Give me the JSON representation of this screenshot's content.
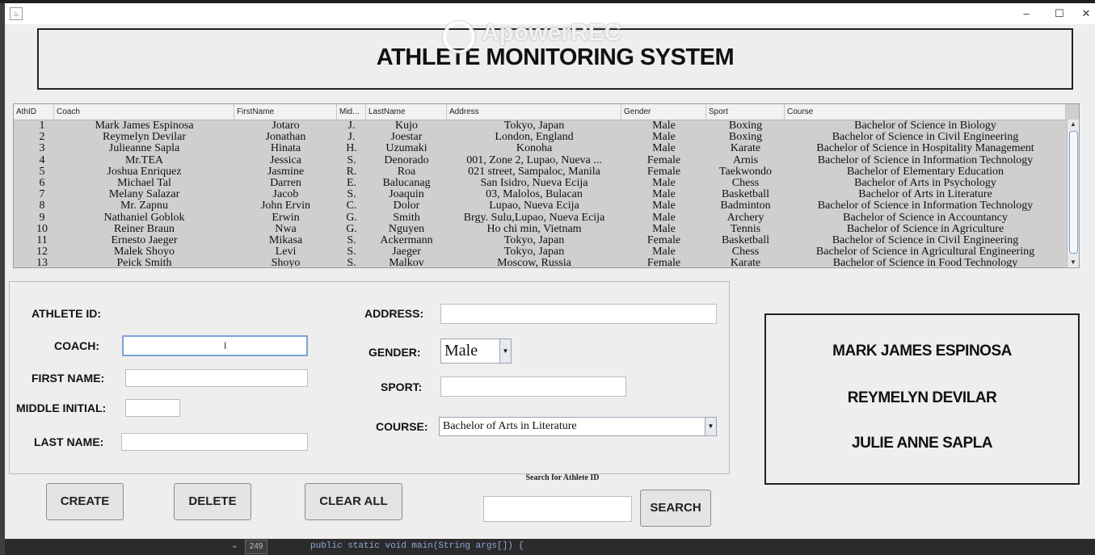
{
  "window": {
    "icon_glyph": "♨",
    "minimize": "–",
    "maximize": "☐",
    "close": "✕"
  },
  "header": {
    "title": "ATHLETE MONITORING SYSTEM",
    "watermark": "ApowerREC"
  },
  "table": {
    "columns": [
      "AthID",
      "Coach",
      "FirstName",
      "Mid...",
      "LastName",
      "Address",
      "Gender",
      "Sport",
      "Course"
    ],
    "rows": [
      [
        "1",
        "Mark James Espinosa",
        "Jotaro",
        "J.",
        "Kujo",
        "Tokyo, Japan",
        "Male",
        "Boxing",
        "Bachelor of Science in Biology"
      ],
      [
        "2",
        "Reymelyn Devilar",
        "Jonathan",
        "J.",
        "Joestar",
        "London, England",
        "Male",
        "Boxing",
        "Bachelor of Science in Civil Engineering"
      ],
      [
        "3",
        "Julieanne Sapla",
        "Hinata",
        "H.",
        "Uzumaki",
        "Konoha",
        "Male",
        "Karate",
        "Bachelor of Science in Hospitality Management"
      ],
      [
        "4",
        "Mr.TEA",
        "Jessica",
        "S.",
        "Denorado",
        "001, Zone 2, Lupao, Nueva ...",
        "Female",
        "Arnis",
        "Bachelor of Science in Information Technology"
      ],
      [
        "5",
        "Joshua Enriquez",
        "Jasmine",
        "R.",
        "Roa",
        "021 street, Sampaloc, Manila",
        "Female",
        "Taekwondo",
        "Bachelor of Elementary Education"
      ],
      [
        "6",
        "Michael Tal",
        "Darren",
        "E.",
        "Balucanag",
        "San Isidro, Nueva Ecija",
        "Male",
        "Chess",
        "Bachelor of Arts in Psychology"
      ],
      [
        "7",
        "Melany Salazar",
        "Jacob",
        "S.",
        "Joaquin",
        "03, Malolos, Bulacan",
        "Male",
        "Basketball",
        "Bachelor of Arts in Literature"
      ],
      [
        "8",
        "Mr. Zapnu",
        "John Ervin",
        "C.",
        "Dolor",
        "Lupao, Nueva Ecija",
        "Male",
        "Badminton",
        "Bachelor of Science in Information Technology"
      ],
      [
        "9",
        "Nathaniel Goblok",
        "Erwin",
        "G.",
        "Smith",
        "Brgy. Sulu,Lupao, Nueva Ecija",
        "Male",
        "Archery",
        "Bachelor of Science in Accountancy"
      ],
      [
        "10",
        "Reiner Braun",
        "Nwa",
        "G.",
        "Nguyen",
        "Ho chi min, Vietnam",
        "Male",
        "Tennis",
        "Bachelor of Science in Agriculture"
      ],
      [
        "11",
        "Ernesto Jaeger",
        "Mikasa",
        "S.",
        "Ackermann",
        "Tokyo, Japan",
        "Female",
        "Basketball",
        "Bachelor of Science in Civil Engineering"
      ],
      [
        "12",
        "Malek Shoyo",
        "Levi",
        "S.",
        "Jaeger",
        "Tokyo, Japan",
        "Male",
        "Chess",
        "Bachelor of Science in Agricultural Engineering"
      ],
      [
        "13",
        "Peick Smith",
        "Shoyo",
        "S.",
        "Malkov",
        "Moscow, Russia",
        "Female",
        "Karate",
        "Bachelor of Science in Food Technology"
      ]
    ],
    "scroll_up": "▲",
    "scroll_down": "▼"
  },
  "form": {
    "athlete_id_label": "ATHLETE ID:",
    "coach_label": "COACH:",
    "first_name_label": "FIRST NAME:",
    "middle_initial_label": "MIDDLE INITIAL:",
    "last_name_label": "LAST NAME:",
    "address_label": "ADDRESS:",
    "gender_label": "GENDER:",
    "sport_label": "SPORT:",
    "course_label": "COURSE:",
    "gender_value": "Male",
    "course_value": "Bachelor of Arts in Literature",
    "coach_value": "",
    "first_name_value": "",
    "middle_initial_value": "",
    "last_name_value": "",
    "address_value": "",
    "sport_value": ""
  },
  "names": [
    "MARK JAMES ESPINOSA",
    "REYMELYN DEVILAR",
    "JULIE ANNE SAPLA"
  ],
  "buttons": {
    "create": "CREATE",
    "delete": "DELETE",
    "clear_all": "CLEAR ALL",
    "search": "SEARCH"
  },
  "search": {
    "label": "Search for Athlete ID",
    "value": ""
  },
  "ide": {
    "line_number": "249",
    "code": "public static void main(String args[]) {"
  }
}
